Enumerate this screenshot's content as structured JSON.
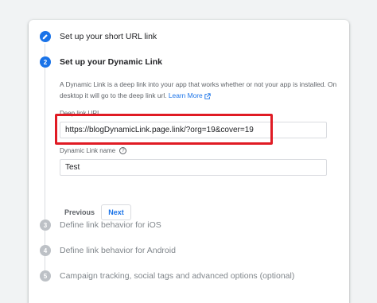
{
  "steps": [
    {
      "number": "",
      "title": "Set up your short URL link",
      "state": "done"
    },
    {
      "number": "2",
      "title": "Set up your Dynamic Link",
      "state": "active"
    },
    {
      "number": "3",
      "title": "Define link behavior for iOS",
      "state": "pending"
    },
    {
      "number": "4",
      "title": "Define link behavior for Android",
      "state": "pending"
    },
    {
      "number": "5",
      "title": "Campaign tracking, social tags and advanced options (optional)",
      "state": "pending"
    }
  ],
  "description": {
    "text": "A Dynamic Link is a deep link into your app that works whether or not your app is installed. On desktop it will go to the deep link url.",
    "learn_more": "Learn More"
  },
  "deep_link": {
    "label": "Deep link URL",
    "value": "https://blogDynamicLink.page.link/?org=19&cover=19"
  },
  "link_name": {
    "label": "Dynamic Link name",
    "value": "Test"
  },
  "buttons": {
    "previous": "Previous",
    "next": "Next"
  },
  "colors": {
    "accent": "#1a73e8",
    "highlight": "#e01b24",
    "pending": "#bdc1c6"
  }
}
